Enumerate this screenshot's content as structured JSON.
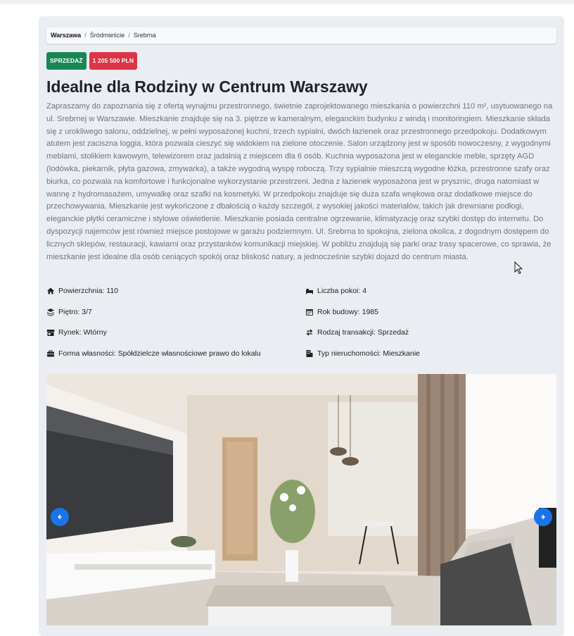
{
  "breadcrumb": [
    "Warszawa",
    "Śródmieście",
    "Srebrna"
  ],
  "badges": {
    "status": "SPRZEDAŻ",
    "price": "1 205 500 PLN"
  },
  "title": "Idealne dla Rodziny w Centrum Warszawy",
  "description": "Zapraszamy do zapoznania się z ofertą wynajmu przestronnego, świetnie zaprojektowanego mieszkania o powierzchni 110 m², usytuowanego na ul. Srebrnej w Warszawie. Mieszkanie znajduje się na 3. piętrze w kameralnym, eleganckim budynku z windą i monitoringiem. Mieszkanie składa się z urokliwego salonu, oddzielnej, w pełni wyposażonej kuchni, trzech sypialni, dwóch łazienek oraz przestronnego przedpokoju. Dodatkowym atutem jest zaciszna loggia, która pozwala cieszyć się widokiem na zielone otoczenie. Salon urządzony jest w sposób nowoczesny, z wygodnymi meblami, stolikiem kawowym, telewizorem oraz jadalnią z miejscem dla 6 osób. Kuchnia wyposażona jest w eleganckie meble, sprzęty AGD (lodówka, piekarnik, płyta gazowa, zmywarka), a także wygodną wyspę roboczą. Trzy sypialnie mieszczą wygodne łóżka, przestronne szafy oraz biurka, co pozwala na komfortowe i funkcjonalne wykorzystanie przestrzeni. Jedna z łazienek wyposażona jest w prysznic, druga natomiast w wannę z hydromasażem, umywalkę oraz szafki na kosmetyki. W przedpokoju znajduje się duża szafa wnękowa oraz dodatkowe miejsce do przechowywania. Mieszkanie jest wykończone z dbałością o każdy szczegół, z wysokiej jakości materiałów, takich jak drewniane podłogi, eleganckie płytki ceramiczne i stylowe oświetlenie. Mieszkanie posiada centralne ogrzewanie, klimatyzację oraz szybki dostęp do internetu. Do dyspozycji najemców jest również miejsce postojowe w garażu podziemnym. Ul. Srebrna to spokojna, zielona okolica, z dogodnym dostępem do licznych sklepów, restauracji, kawiarni oraz przystanków komunikacji miejskiej. W pobliżu znajdują się parki oraz trasy spacerowe, co sprawia, że mieszkanie jest idealne dla osób ceniących spokój oraz bliskość natury, a jednocześnie szybki dojazd do centrum miasta.",
  "properties": {
    "area": "Powierzchnia: 110",
    "rooms": "Liczba pokoi: 4",
    "floor": "Piętro: 3/7",
    "year": "Rok budowy: 1985",
    "market": "Rynek: Wtórny",
    "transaction": "Rodzaj transakcji: Sprzedaż",
    "ownership": "Forma własności: Spółdzielcze własnościowe prawo do lokalu",
    "type": "Typ nieruchomości: Mieszkanie"
  },
  "icons": {
    "area": "home-icon",
    "rooms": "bed-icon",
    "floor": "layers-icon",
    "year": "calendar-icon",
    "market": "store-icon",
    "transaction": "exchange-icon",
    "ownership": "briefcase-icon",
    "type": "building-icon"
  },
  "colors": {
    "status_badge": "#198754",
    "price_badge": "#dc3545",
    "carousel_button": "#1a73e8",
    "card_background": "#eaeef3"
  }
}
